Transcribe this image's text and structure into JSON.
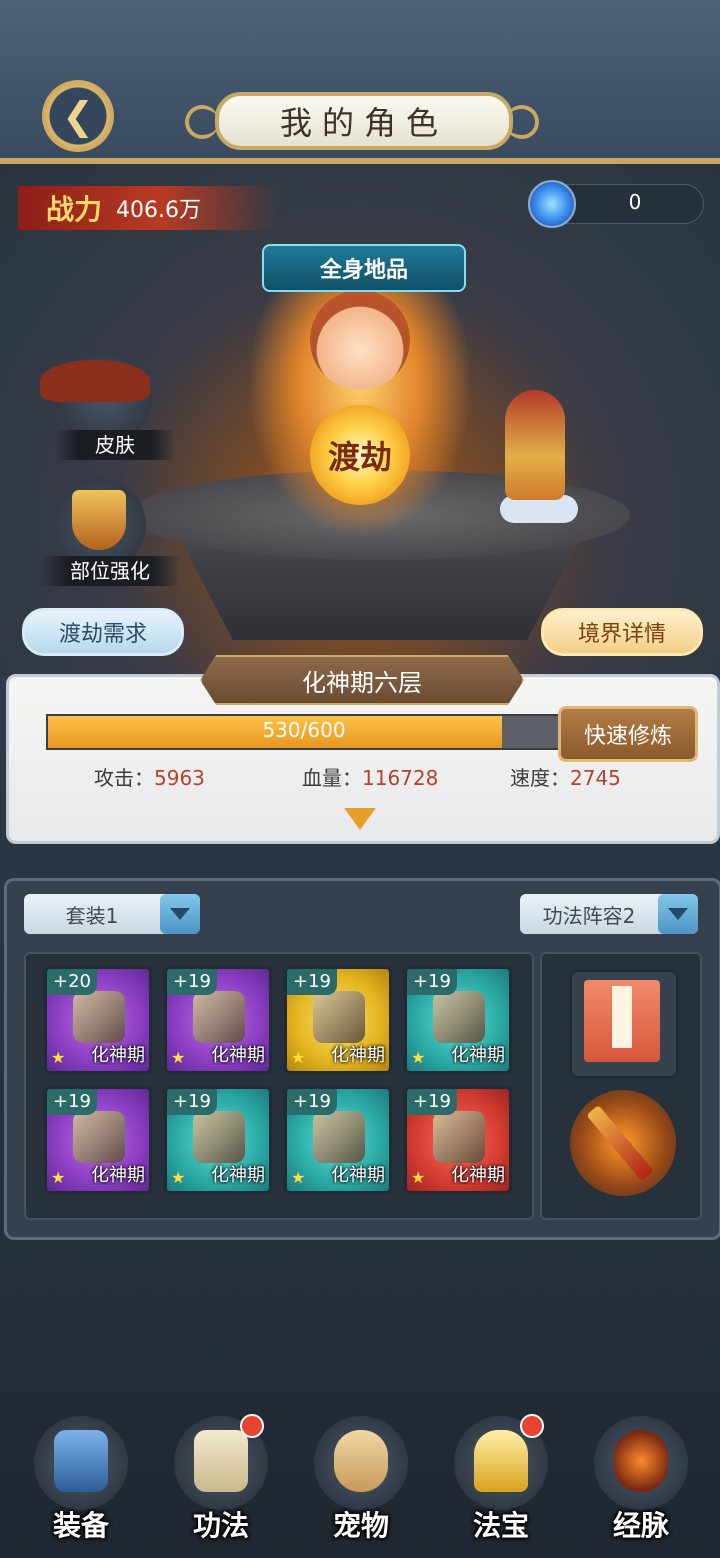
{
  "header": {
    "title": "我的角色",
    "back_icon": "back-arrow-icon"
  },
  "combat": {
    "label": "战力",
    "value": "406.6万"
  },
  "currency": {
    "icon": "spirit-gem-icon",
    "value": "0"
  },
  "character": {
    "grade_label": "全身地品",
    "orb_label": "渡劫"
  },
  "side_buttons": {
    "skin_label": "皮肤",
    "enhance_label": "部位强化"
  },
  "actions": {
    "tribulation_req": "渡劫需求",
    "realm_details": "境界详情"
  },
  "realm": {
    "title": "化神期六层",
    "exp_current": 530,
    "exp_max": 600,
    "exp_text": "530/600",
    "quick_cultivate": "快速修炼",
    "stats": [
      {
        "label": "攻击：",
        "value": "5963"
      },
      {
        "label": "血量：",
        "value": "116728"
      },
      {
        "label": "速度：",
        "value": "2745"
      }
    ]
  },
  "equipment": {
    "set_select": "套装1",
    "technique_select": "功法阵容2",
    "items": [
      {
        "level": "+20",
        "realm": "化神期",
        "rarity": "purple",
        "icon": "sword-icon"
      },
      {
        "level": "+19",
        "realm": "化神期",
        "rarity": "purple",
        "icon": "armor-icon"
      },
      {
        "level": "+19",
        "realm": "化神期",
        "rarity": "gold",
        "icon": "helmet-icon"
      },
      {
        "level": "+19",
        "realm": "化神期",
        "rarity": "teal",
        "icon": "boots-icon"
      },
      {
        "level": "+19",
        "realm": "化神期",
        "rarity": "purple",
        "icon": "necklace-icon"
      },
      {
        "level": "+19",
        "realm": "化神期",
        "rarity": "teal",
        "icon": "bracelet-icon"
      },
      {
        "level": "+19",
        "realm": "化神期",
        "rarity": "teal",
        "icon": "ring-icon"
      },
      {
        "level": "+19",
        "realm": "化神期",
        "rarity": "red",
        "icon": "amulet-icon"
      }
    ],
    "technique_book": {
      "icon": "technique-book-icon"
    },
    "weapon": {
      "icon": "flame-sword-icon"
    }
  },
  "nav": [
    {
      "label": "装备",
      "icon": "armor-nav-icon",
      "badge": false
    },
    {
      "label": "功法",
      "icon": "scroll-nav-icon",
      "badge": true
    },
    {
      "label": "宠物",
      "icon": "pet-nav-icon",
      "badge": false
    },
    {
      "label": "法宝",
      "icon": "treasure-nav-icon",
      "badge": true
    },
    {
      "label": "经脉",
      "icon": "meridian-nav-icon",
      "badge": false
    }
  ]
}
